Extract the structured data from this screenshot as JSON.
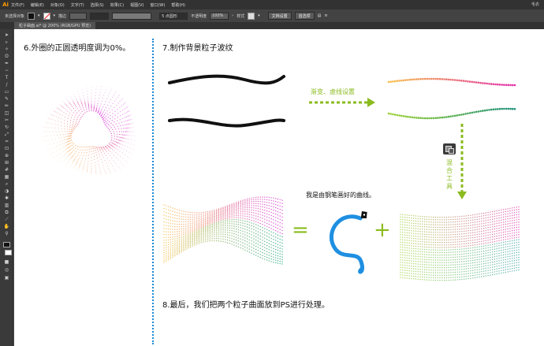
{
  "app": {
    "logo": "Ai",
    "menu": [
      "文件(F)",
      "编辑(E)",
      "对象(O)",
      "文字(T)",
      "选择(S)",
      "效果(C)",
      "视图(V)",
      "窗口(W)",
      "帮助(H)"
    ],
    "right_label": "毛衣"
  },
  "controlbar": {
    "selection_label": "未选择对象",
    "stroke_label": "描边",
    "stroke_value": "",
    "profile_label": "5 点圆形",
    "opacity_label": "不透明度",
    "opacity_value": "100%",
    "style_label": "样式",
    "doc_setup_button": "文档设置",
    "prefs_button": "首选项"
  },
  "document": {
    "tab_title": "粒子曲面.ai* @ 200% (RGB/GPU 预览)"
  },
  "canvas": {
    "step6": "6.外圈的正圆透明度调为0%。",
    "step7": "7.制作背景粒子波纹",
    "gradient_label": "渐变、虚线设置",
    "blend_label": [
      "混",
      "合",
      "工",
      "具"
    ],
    "pen_label": "我是由钢笔画好的曲线。",
    "equals": "=",
    "plus": "+",
    "step8": "8.最后，我们把两个粒子曲面放到PS进行处理。"
  },
  "colors": {
    "accent_green": "#8bbb1f",
    "divider_blue": "#1a8bd5",
    "curve_blue": "#1e8fe1"
  }
}
